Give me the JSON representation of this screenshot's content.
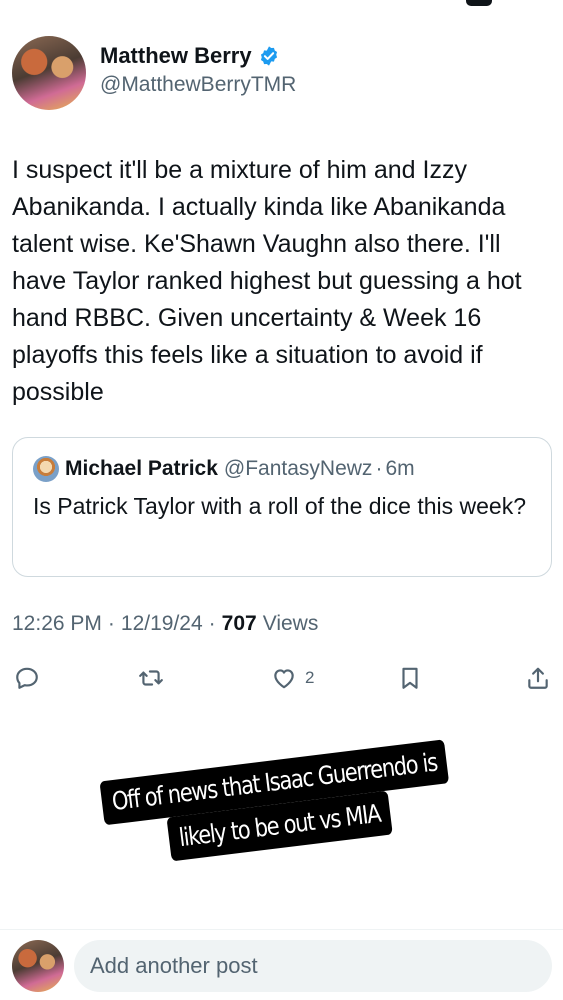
{
  "author": {
    "display_name": "Matthew Berry",
    "handle": "@MatthewBerryTMR",
    "verified": true
  },
  "post": {
    "text": "I suspect it'll be a mixture of him and Izzy Abanikanda. I actually kinda like Abanikanda talent wise. Ke'Shawn Vaughn also there. I'll have Taylor ranked highest but guessing a hot hand RBBC. Given uncertainty & Week 16 playoffs this feels like a situation to avoid if possible"
  },
  "quoted_post": {
    "name": "Michael Patrick",
    "handle": "@FantasyNewz",
    "separator": "·",
    "time": "6m",
    "text": "Is Patrick Taylor with a roll of the dice this week?"
  },
  "meta": {
    "time": "12:26 PM",
    "dot": "·",
    "date": "12/19/24",
    "views_count": "707",
    "views_label": "Views"
  },
  "actions": {
    "like_count": "2",
    "icons": [
      "reply-icon",
      "repost-icon",
      "like-icon",
      "bookmark-icon",
      "share-icon"
    ]
  },
  "story_caption": {
    "line1": "Off of news that Isaac Guerrendo is",
    "line2": "likely to be out vs MIA"
  },
  "reply_bar": {
    "placeholder": "Add another post"
  },
  "colors": {
    "text": "#0f1419",
    "secondary": "#536471",
    "accent": "#1d9bf0",
    "border": "#cfd9de",
    "input_bg": "#eff3f4"
  }
}
